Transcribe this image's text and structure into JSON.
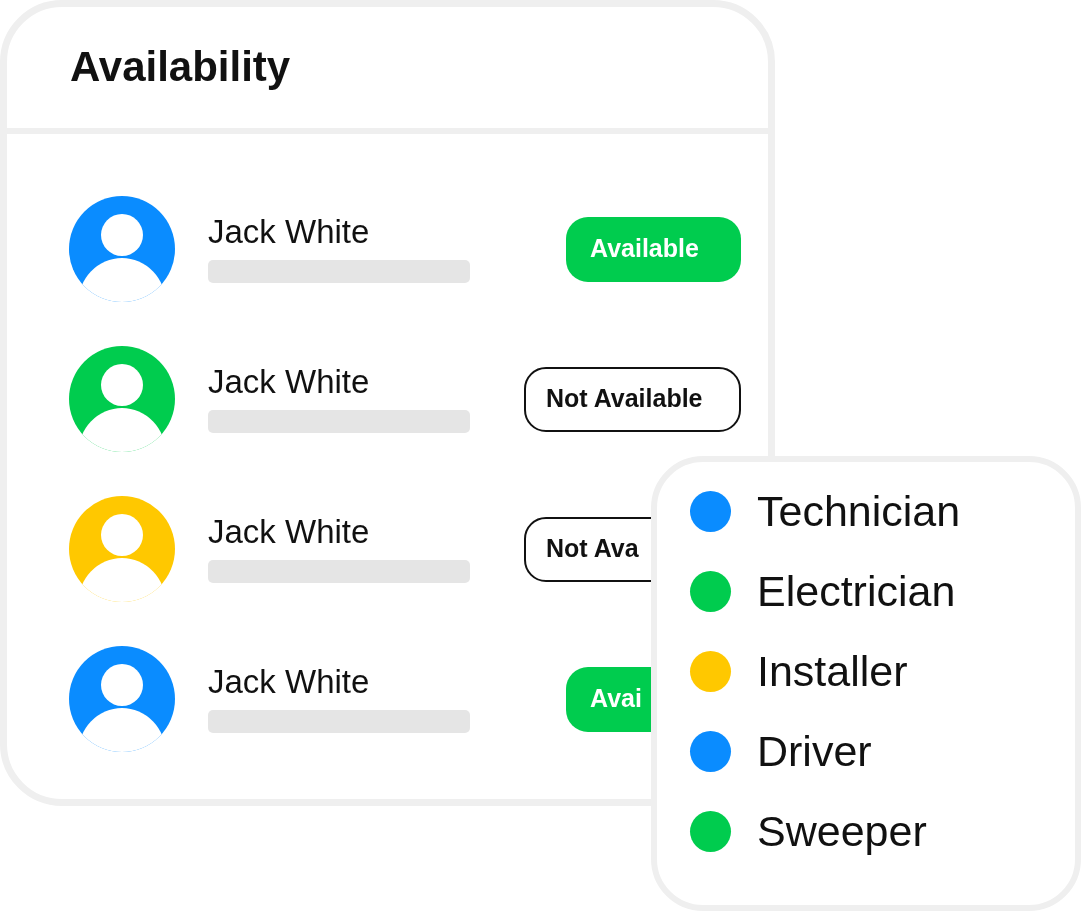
{
  "card": {
    "title": "Availability"
  },
  "people": [
    {
      "name": "Jack White",
      "color": "#0a8cff",
      "status": {
        "kind": "available",
        "text": "Available"
      }
    },
    {
      "name": "Jack White",
      "color": "#00cc4e",
      "status": {
        "kind": "not-available",
        "text": "Not Available"
      }
    },
    {
      "name": "Jack White",
      "color": "#ffc800",
      "status": {
        "kind": "not-available",
        "text": "Not Ava"
      }
    },
    {
      "name": "Jack White",
      "color": "#0a8cff",
      "status": {
        "kind": "available",
        "text": "Avai"
      }
    }
  ],
  "legend": {
    "items": [
      {
        "label": "Technician",
        "color": "#0a8cff"
      },
      {
        "label": "Electrician",
        "color": "#00cc4e"
      },
      {
        "label": "Installer",
        "color": "#ffc800"
      },
      {
        "label": "Driver",
        "color": "#0a8cff"
      },
      {
        "label": "Sweeper",
        "color": "#00cc4e"
      }
    ]
  }
}
